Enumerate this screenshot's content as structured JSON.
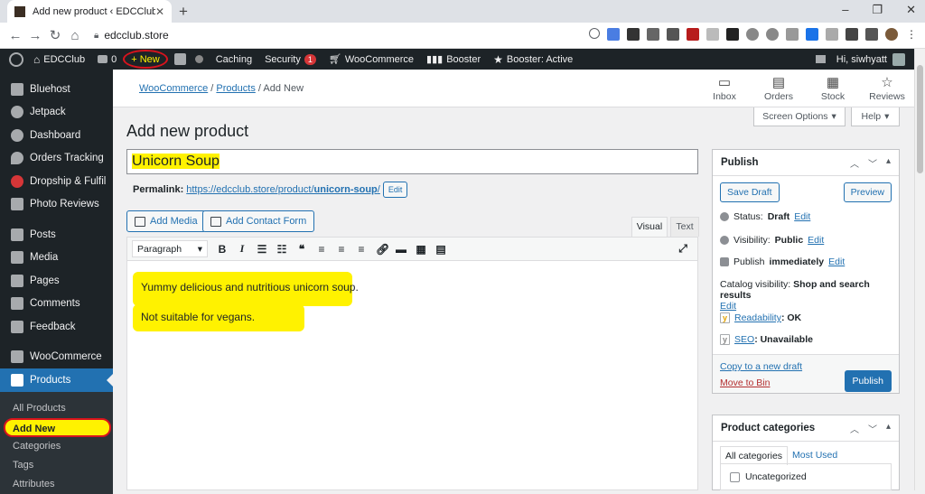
{
  "browser": {
    "tab_title": "Add new product ‹ EDCClub — W",
    "tab_close": "✕",
    "new_tab": "+",
    "url": "edcclub.store",
    "win_min": "–",
    "win_max": "❐",
    "win_close": "✕"
  },
  "adminbar": {
    "site": "EDCClub",
    "comments": "0",
    "new": "+ New",
    "caching": "Caching",
    "security": "Security",
    "security_count": "1",
    "woocommerce": "WooCommerce",
    "booster": "Booster",
    "booster_active": "Booster: Active",
    "greeting": "Hi, siwhyatt"
  },
  "sidebar": {
    "items": [
      {
        "label": "Bluehost",
        "icon": "grid-icon"
      },
      {
        "label": "Jetpack",
        "icon": "jetpack-icon"
      },
      {
        "label": "Dashboard",
        "icon": "dashboard-icon"
      },
      {
        "label": "Orders Tracking",
        "icon": "location-pin-icon"
      },
      {
        "label": "Dropship & Fulfil",
        "icon": "dropship-icon"
      },
      {
        "label": "Photo Reviews",
        "icon": "star-icon"
      },
      {
        "label": "Posts",
        "icon": "pin-icon"
      },
      {
        "label": "Media",
        "icon": "media-icon"
      },
      {
        "label": "Pages",
        "icon": "pages-icon"
      },
      {
        "label": "Comments",
        "icon": "comment-icon"
      },
      {
        "label": "Feedback",
        "icon": "feedback-icon"
      },
      {
        "label": "WooCommerce",
        "icon": "woo-icon"
      },
      {
        "label": "Products",
        "icon": "products-icon"
      }
    ],
    "submenu": [
      "All Products",
      "Add New",
      "Categories",
      "Tags",
      "Attributes"
    ]
  },
  "wcheader": {
    "crumb_woo": "WooCommerce",
    "crumb_products": "Products",
    "crumb_current": "Add New",
    "sep": "/",
    "actions": [
      {
        "label": "Inbox",
        "icon": "inbox-icon"
      },
      {
        "label": "Orders",
        "icon": "orders-icon"
      },
      {
        "label": "Stock",
        "icon": "stock-icon"
      },
      {
        "label": "Reviews",
        "icon": "reviews-icon"
      }
    ]
  },
  "screen_options": "Screen Options",
  "help": "Help",
  "page_title": "Add new product",
  "product_title": "Unicorn Soup",
  "permalink": {
    "label": "Permalink:",
    "url_base": "https://edcclub.store/product/",
    "slug": "unicorn-soup",
    "url_end": "/",
    "edit": "Edit"
  },
  "media": {
    "add_media": "Add Media",
    "add_contact_form": "Add Contact Form"
  },
  "editor_tabs": {
    "visual": "Visual",
    "text": "Text"
  },
  "format_select": "Paragraph",
  "editor_content": [
    "Yummy delicious and nutritious unicorn soup.",
    "Not suitable for vegans."
  ],
  "publish": {
    "title": "Publish",
    "save_draft": "Save Draft",
    "preview": "Preview",
    "status_label": "Status:",
    "status_value": "Draft",
    "visibility_label": "Visibility:",
    "visibility_value": "Public",
    "publish_label": "Publish",
    "publish_value": "immediately",
    "edit": "Edit",
    "catalog_label": "Catalog visibility:",
    "catalog_value": "Shop and search results",
    "readability_label": "Readability",
    "readability_value": ": OK",
    "seo_label": "SEO",
    "seo_value": ": Unavailable",
    "copy_draft": "Copy to a new draft",
    "move_bin": "Move to Bin",
    "publish_button": "Publish"
  },
  "categories": {
    "title": "Product categories",
    "tab_all": "All categories",
    "tab_used": "Most Used",
    "item": "Uncategorized"
  }
}
